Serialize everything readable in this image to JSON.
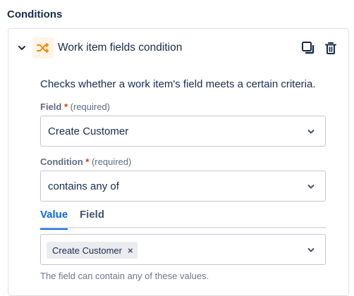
{
  "section": {
    "title": "Conditions"
  },
  "card": {
    "title": "Work item fields condition",
    "icon": "shuffle-icon",
    "description": "Checks whether a work item's field meets a certain criteria."
  },
  "field": {
    "label": "Field",
    "required_star": "*",
    "required_text": "(required)",
    "value": "Create Customer"
  },
  "condition": {
    "label": "Condition",
    "required_star": "*",
    "required_text": "(required)",
    "value": "contains any of"
  },
  "tabs": [
    {
      "label": "Value",
      "active": true
    },
    {
      "label": "Field",
      "active": false
    }
  ],
  "value_select": {
    "chips": [
      {
        "label": "Create Customer",
        "remove": "×"
      }
    ]
  },
  "helper": "The field can contain any of these values.",
  "colors": {
    "accent": "#0c66e4",
    "icon_orange": "#f18d13",
    "required": "#de350b"
  }
}
